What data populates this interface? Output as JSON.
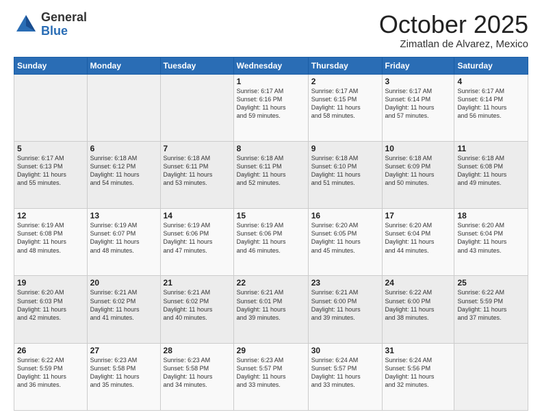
{
  "logo": {
    "general": "General",
    "blue": "Blue"
  },
  "header": {
    "month": "October 2025",
    "location": "Zimatlan de Alvarez, Mexico"
  },
  "weekdays": [
    "Sunday",
    "Monday",
    "Tuesday",
    "Wednesday",
    "Thursday",
    "Friday",
    "Saturday"
  ],
  "weeks": [
    [
      {
        "day": "",
        "info": ""
      },
      {
        "day": "",
        "info": ""
      },
      {
        "day": "",
        "info": ""
      },
      {
        "day": "1",
        "info": "Sunrise: 6:17 AM\nSunset: 6:16 PM\nDaylight: 11 hours\nand 59 minutes."
      },
      {
        "day": "2",
        "info": "Sunrise: 6:17 AM\nSunset: 6:15 PM\nDaylight: 11 hours\nand 58 minutes."
      },
      {
        "day": "3",
        "info": "Sunrise: 6:17 AM\nSunset: 6:14 PM\nDaylight: 11 hours\nand 57 minutes."
      },
      {
        "day": "4",
        "info": "Sunrise: 6:17 AM\nSunset: 6:14 PM\nDaylight: 11 hours\nand 56 minutes."
      }
    ],
    [
      {
        "day": "5",
        "info": "Sunrise: 6:17 AM\nSunset: 6:13 PM\nDaylight: 11 hours\nand 55 minutes."
      },
      {
        "day": "6",
        "info": "Sunrise: 6:18 AM\nSunset: 6:12 PM\nDaylight: 11 hours\nand 54 minutes."
      },
      {
        "day": "7",
        "info": "Sunrise: 6:18 AM\nSunset: 6:11 PM\nDaylight: 11 hours\nand 53 minutes."
      },
      {
        "day": "8",
        "info": "Sunrise: 6:18 AM\nSunset: 6:11 PM\nDaylight: 11 hours\nand 52 minutes."
      },
      {
        "day": "9",
        "info": "Sunrise: 6:18 AM\nSunset: 6:10 PM\nDaylight: 11 hours\nand 51 minutes."
      },
      {
        "day": "10",
        "info": "Sunrise: 6:18 AM\nSunset: 6:09 PM\nDaylight: 11 hours\nand 50 minutes."
      },
      {
        "day": "11",
        "info": "Sunrise: 6:18 AM\nSunset: 6:08 PM\nDaylight: 11 hours\nand 49 minutes."
      }
    ],
    [
      {
        "day": "12",
        "info": "Sunrise: 6:19 AM\nSunset: 6:08 PM\nDaylight: 11 hours\nand 48 minutes."
      },
      {
        "day": "13",
        "info": "Sunrise: 6:19 AM\nSunset: 6:07 PM\nDaylight: 11 hours\nand 48 minutes."
      },
      {
        "day": "14",
        "info": "Sunrise: 6:19 AM\nSunset: 6:06 PM\nDaylight: 11 hours\nand 47 minutes."
      },
      {
        "day": "15",
        "info": "Sunrise: 6:19 AM\nSunset: 6:06 PM\nDaylight: 11 hours\nand 46 minutes."
      },
      {
        "day": "16",
        "info": "Sunrise: 6:20 AM\nSunset: 6:05 PM\nDaylight: 11 hours\nand 45 minutes."
      },
      {
        "day": "17",
        "info": "Sunrise: 6:20 AM\nSunset: 6:04 PM\nDaylight: 11 hours\nand 44 minutes."
      },
      {
        "day": "18",
        "info": "Sunrise: 6:20 AM\nSunset: 6:04 PM\nDaylight: 11 hours\nand 43 minutes."
      }
    ],
    [
      {
        "day": "19",
        "info": "Sunrise: 6:20 AM\nSunset: 6:03 PM\nDaylight: 11 hours\nand 42 minutes."
      },
      {
        "day": "20",
        "info": "Sunrise: 6:21 AM\nSunset: 6:02 PM\nDaylight: 11 hours\nand 41 minutes."
      },
      {
        "day": "21",
        "info": "Sunrise: 6:21 AM\nSunset: 6:02 PM\nDaylight: 11 hours\nand 40 minutes."
      },
      {
        "day": "22",
        "info": "Sunrise: 6:21 AM\nSunset: 6:01 PM\nDaylight: 11 hours\nand 39 minutes."
      },
      {
        "day": "23",
        "info": "Sunrise: 6:21 AM\nSunset: 6:00 PM\nDaylight: 11 hours\nand 39 minutes."
      },
      {
        "day": "24",
        "info": "Sunrise: 6:22 AM\nSunset: 6:00 PM\nDaylight: 11 hours\nand 38 minutes."
      },
      {
        "day": "25",
        "info": "Sunrise: 6:22 AM\nSunset: 5:59 PM\nDaylight: 11 hours\nand 37 minutes."
      }
    ],
    [
      {
        "day": "26",
        "info": "Sunrise: 6:22 AM\nSunset: 5:59 PM\nDaylight: 11 hours\nand 36 minutes."
      },
      {
        "day": "27",
        "info": "Sunrise: 6:23 AM\nSunset: 5:58 PM\nDaylight: 11 hours\nand 35 minutes."
      },
      {
        "day": "28",
        "info": "Sunrise: 6:23 AM\nSunset: 5:58 PM\nDaylight: 11 hours\nand 34 minutes."
      },
      {
        "day": "29",
        "info": "Sunrise: 6:23 AM\nSunset: 5:57 PM\nDaylight: 11 hours\nand 33 minutes."
      },
      {
        "day": "30",
        "info": "Sunrise: 6:24 AM\nSunset: 5:57 PM\nDaylight: 11 hours\nand 33 minutes."
      },
      {
        "day": "31",
        "info": "Sunrise: 6:24 AM\nSunset: 5:56 PM\nDaylight: 11 hours\nand 32 minutes."
      },
      {
        "day": "",
        "info": ""
      }
    ]
  ]
}
